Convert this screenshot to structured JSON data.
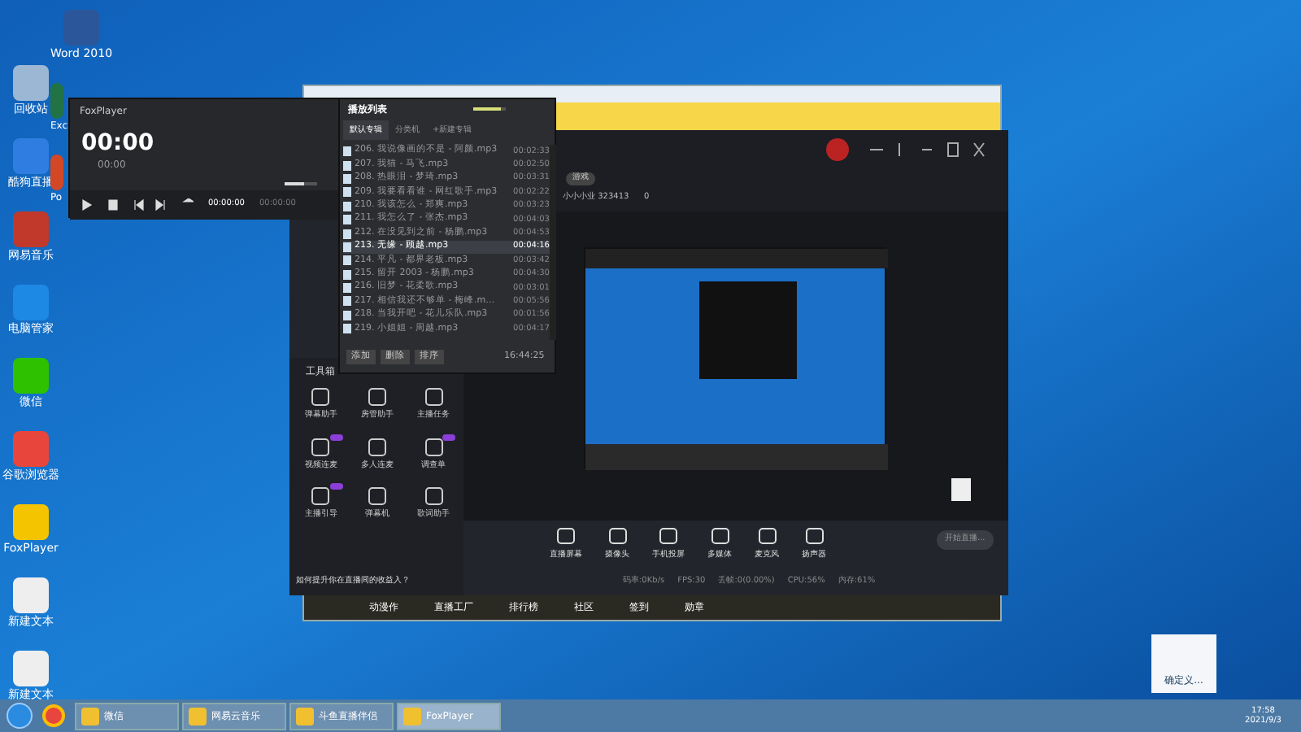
{
  "desktop_icons": [
    {
      "label": "回收站",
      "color": "#9bb7d4"
    },
    {
      "label": "酷狗直播",
      "color": "#2f7de1"
    },
    {
      "label": "网易音乐",
      "color": "#c0392b"
    },
    {
      "label": "电脑管家",
      "color": "#1e88e5"
    },
    {
      "label": "微信",
      "color": "#2dc100"
    },
    {
      "label": "谷歌浏览器",
      "color": "#e8453c"
    },
    {
      "label": "FoxPlayer",
      "color": "#f5c400"
    },
    {
      "label": "新建文本",
      "color": "#eeeeee"
    },
    {
      "label": "新建文本",
      "color": "#eeeeee"
    }
  ],
  "desktop_icons_2": [
    {
      "label": "Word 2010",
      "color": "#2b579a",
      "clipped": false
    },
    {
      "label": "Exc",
      "color": "#217346",
      "clipped": true
    },
    {
      "label": "Po",
      "color": "#d24726",
      "clipped": true
    }
  ],
  "player": {
    "title": "FoxPlayer",
    "time": "00:00",
    "subtime": "00:00",
    "position": "00:00:00",
    "duration": "00:00:00",
    "volume": {
      "level": 0.6
    }
  },
  "playlist": {
    "title": "播放列表",
    "volume": {
      "level": 0.85
    },
    "tabs": [
      {
        "label": "默认专辑",
        "selected": true
      },
      {
        "label": "分类机",
        "selected": false
      },
      {
        "label": "+新建专辑",
        "selected": false
      }
    ],
    "songs": [
      {
        "title": "206. 我说像画的不是 - 阿颜.mp3",
        "duration": "00:02:33",
        "selected": false
      },
      {
        "title": "207. 我猫 - 马飞.mp3",
        "duration": "00:02:50",
        "selected": false
      },
      {
        "title": "208. 热眼泪 - 梦琦.mp3",
        "duration": "00:03:31",
        "selected": false
      },
      {
        "title": "209. 我要看看谁 - 网红歌手.mp3",
        "duration": "00:02:22",
        "selected": false
      },
      {
        "title": "210. 我该怎么 - 郑爽.mp3",
        "duration": "00:03:23",
        "selected": false
      },
      {
        "title": "211. 我怎么了 - 张杰.mp3",
        "duration": "00:04:03",
        "selected": false
      },
      {
        "title": "212. 在没见到之前 - 杨鹏.mp3",
        "duration": "00:04:53",
        "selected": false
      },
      {
        "title": "213. 无缘 - 顾越.mp3",
        "duration": "00:04:16",
        "selected": true
      },
      {
        "title": "214. 平凡 - 都界老板.mp3",
        "duration": "00:03:42",
        "selected": false
      },
      {
        "title": "215. 留开 2003 - 杨鹏.mp3",
        "duration": "00:04:30",
        "selected": false
      },
      {
        "title": "216. 旧梦 - 花柔歌.mp3",
        "duration": "00:03:01",
        "selected": false
      },
      {
        "title": "217. 相信我还不够单 - 梅峰.m…",
        "duration": "00:05:56",
        "selected": false
      },
      {
        "title": "218. 当我开吧 - 花儿乐队.mp3",
        "duration": "00:01:56",
        "selected": false
      },
      {
        "title": "219. 小姐姐 - 周越.mp3",
        "duration": "00:04:17",
        "selected": false
      }
    ],
    "buttons": [
      "添加",
      "删除",
      "排序"
    ],
    "total": "16:44:25"
  },
  "live_app": {
    "room_tag": "游戏",
    "room_info": "小小小业 323413",
    "likes": "0",
    "toolbox": {
      "title": "工具箱",
      "tools": [
        {
          "label": "弹幕助手",
          "badge": false
        },
        {
          "label": "房管助手",
          "badge": false
        },
        {
          "label": "主播任务",
          "badge": false
        },
        {
          "label": "视频连麦",
          "badge": true
        },
        {
          "label": "多人连麦",
          "badge": false
        },
        {
          "label": "调查单",
          "badge": true
        },
        {
          "label": "主播引导",
          "badge": true
        },
        {
          "label": "弹幕机",
          "badge": false
        },
        {
          "label": "歌词助手",
          "badge": false
        }
      ]
    },
    "hint": "如何提升你在直播间的收益入？",
    "controls": [
      {
        "label": "直播屏幕"
      },
      {
        "label": "摄像头"
      },
      {
        "label": "手机投屏"
      },
      {
        "label": "多媒体"
      },
      {
        "label": "麦克风"
      },
      {
        "label": "扬声器"
      }
    ],
    "start_button": "开始直播...",
    "stats": [
      "码率:0Kb/s",
      "FPS:30",
      "丢帧:0(0.00%)",
      "CPU:56%",
      "内存:61%"
    ],
    "bottom_tabs": [
      "动漫作",
      "直播工厂",
      "排行榜",
      "社区",
      "签到",
      "勋章"
    ]
  },
  "notification": "确定义...",
  "taskbar": {
    "items": [
      {
        "label": "微信",
        "selected": false
      },
      {
        "label": "网易云音乐",
        "selected": false
      },
      {
        "label": "斗鱼直播伴侣",
        "selected": false
      },
      {
        "label": "FoxPlayer",
        "selected": true
      }
    ],
    "time": "17:58",
    "date": "2021/9/3"
  }
}
